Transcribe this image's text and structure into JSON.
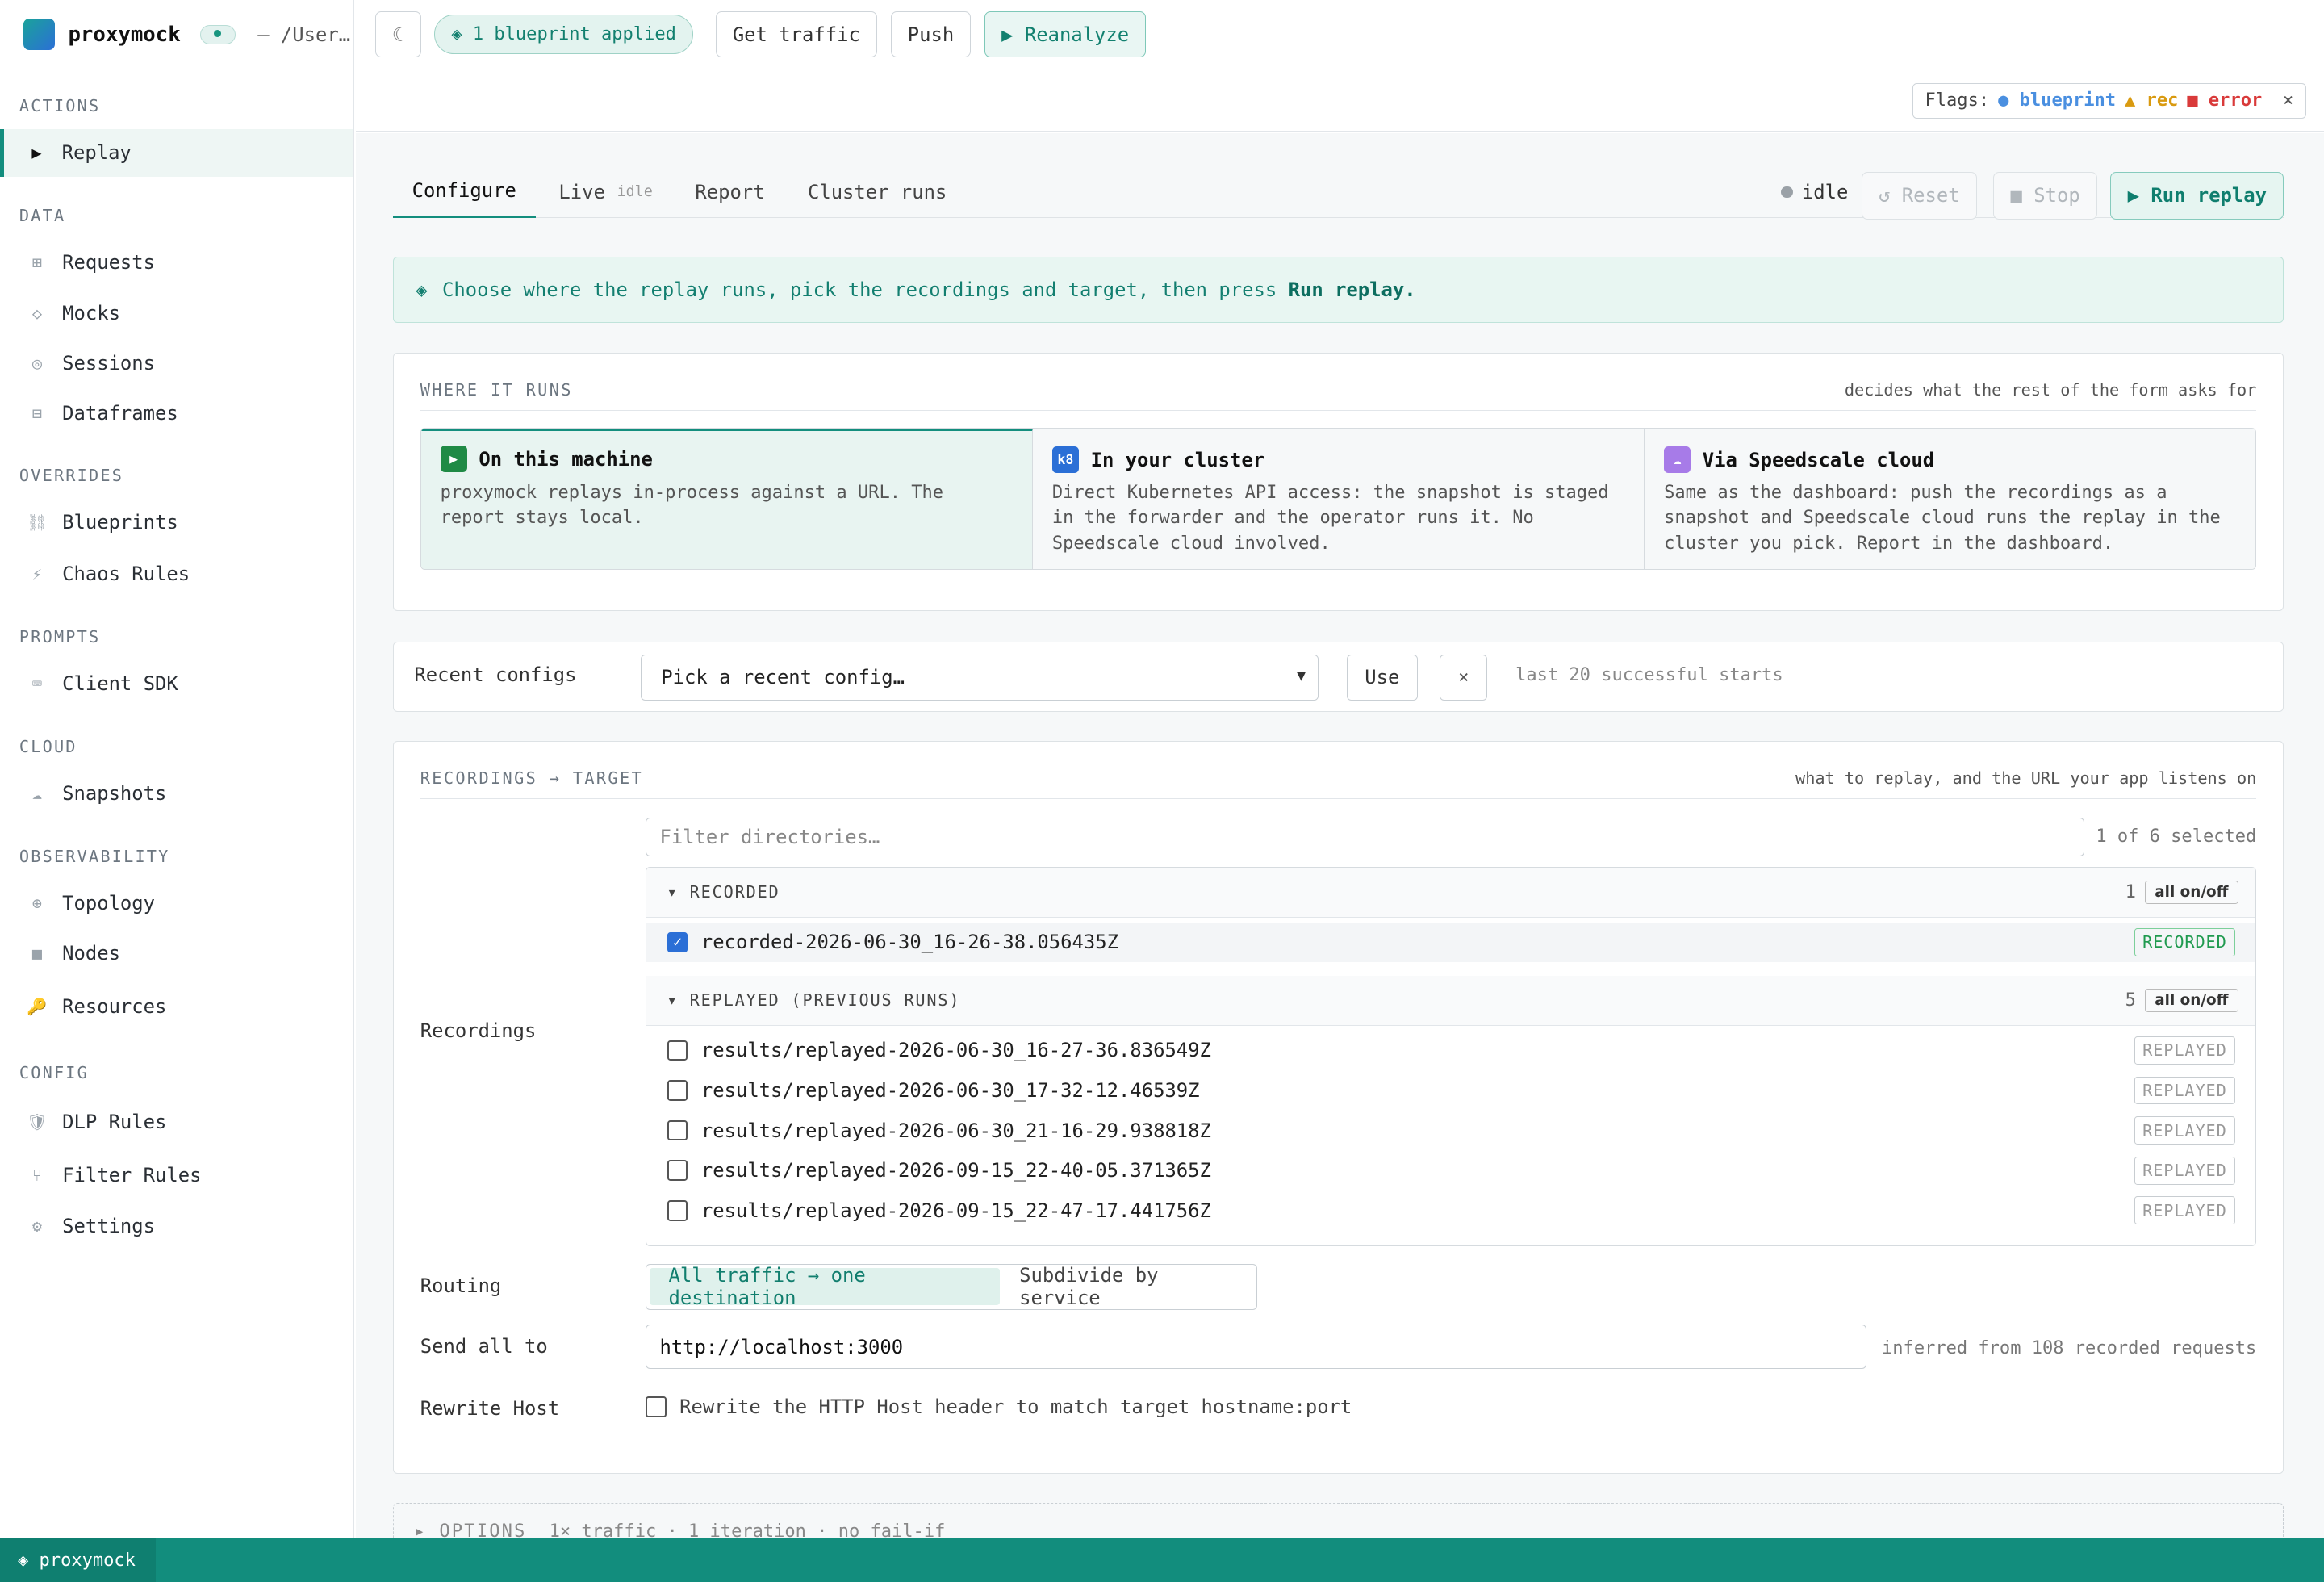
{
  "app": {
    "name": "proxymock",
    "path": "— /User…"
  },
  "topbar": {
    "moon": "☾",
    "blueprint": "◈ 1 blueprint applied",
    "get_traffic": "Get traffic",
    "push": "Push",
    "reanalyze": "▶ Reanalyze"
  },
  "flags": {
    "label": "Flags:",
    "blueprint": "● blueprint",
    "rec": "▲ rec",
    "error": "■ error",
    "close": "×"
  },
  "sidebar": {
    "sections": {
      "actions": "ACTIONS",
      "data": "DATA",
      "overrides": "OVERRIDES",
      "prompts": "PROMPTS",
      "cloud": "CLOUD",
      "observability": "OBSERVABILITY",
      "config": "CONFIG"
    },
    "items": [
      {
        "icon": "▶",
        "label": "Replay"
      },
      {
        "icon": "⊞",
        "label": "Requests"
      },
      {
        "icon": "◇",
        "label": "Mocks"
      },
      {
        "icon": "◎",
        "label": "Sessions"
      },
      {
        "icon": "⊟",
        "label": "Dataframes"
      },
      {
        "icon": "⛓",
        "label": "Blueprints"
      },
      {
        "icon": "⚡",
        "label": "Chaos Rules"
      },
      {
        "icon": "⌨",
        "label": "Client SDK"
      },
      {
        "icon": "☁",
        "label": "Snapshots"
      },
      {
        "icon": "⊕",
        "label": "Topology"
      },
      {
        "icon": "■",
        "label": "Nodes"
      },
      {
        "icon": "🔑",
        "label": "Resources"
      },
      {
        "icon": "🛡",
        "label": "DLP Rules"
      },
      {
        "icon": "⑂",
        "label": "Filter Rules"
      },
      {
        "icon": "⚙",
        "label": "Settings"
      }
    ]
  },
  "tabs": {
    "configure": "Configure",
    "live": "Live",
    "live_sub": "idle",
    "report": "Report",
    "cluster": "Cluster runs"
  },
  "run_state": {
    "status": "idle",
    "reset": "↺ Reset",
    "stop": "■ Stop",
    "run": "▶ Run replay"
  },
  "hint": {
    "icon": "◈",
    "text": "Choose where the replay runs, pick the recordings and target, then press",
    "emphasis": "Run replay."
  },
  "where": {
    "title": "WHERE IT RUNS",
    "note": "decides what the rest of the form asks for",
    "modes": [
      {
        "icon": "▶",
        "title": "On this machine",
        "desc": "proxymock replays in-process against a URL. The report stays local.",
        "color": "#1f8a45"
      },
      {
        "icon": "k8",
        "title": "In your cluster",
        "desc": "Direct Kubernetes API access: the snapshot is staged in the forwarder and the operator runs it. No Speedscale cloud involved.",
        "color": "#2b6fd6"
      },
      {
        "icon": "☁",
        "title": "Via Speedscale cloud",
        "desc": "Same as the dashboard: push the recordings as a snapshot and Speedscale cloud runs the replay in the cluster you pick. Report in the dashboard.",
        "color": "#a77be8"
      }
    ]
  },
  "recent": {
    "label": "Recent configs",
    "select": "Pick a recent config…",
    "use": "Use",
    "clear": "×",
    "note": "last 20 successful starts"
  },
  "recordings": {
    "title": "RECORDINGS → TARGET",
    "note": "what to replay, and the URL your app listens on",
    "label": "Recordings",
    "filter_placeholder": "Filter directories…",
    "selected": "1 of 6 selected",
    "recorded_group": {
      "title": "▾ RECORDED",
      "count": "1",
      "toggle": "all on/off"
    },
    "recorded_items": [
      {
        "name": "recorded-2026-06-30_16-26-38.056435Z",
        "tag": "RECORDED"
      }
    ],
    "replayed_group": {
      "title": "▾ REPLAYED (PREVIOUS RUNS)",
      "count": "5",
      "toggle": "all on/off"
    },
    "replayed_items": [
      {
        "name": "results/replayed-2026-06-30_16-27-36.836549Z",
        "tag": "REPLAYED"
      },
      {
        "name": "results/replayed-2026-06-30_17-32-12.46539Z",
        "tag": "REPLAYED"
      },
      {
        "name": "results/replayed-2026-06-30_21-16-29.938818Z",
        "tag": "REPLAYED"
      },
      {
        "name": "results/replayed-2026-09-15_22-40-05.371365Z",
        "tag": "REPLAYED"
      },
      {
        "name": "results/replayed-2026-09-15_22-47-17.441756Z",
        "tag": "REPLAYED"
      }
    ],
    "routing_label": "Routing",
    "routing_all": "All traffic → one destination",
    "routing_sub": "Subdivide by service",
    "send_label": "Send all to",
    "send_value": "http://localhost:3000",
    "send_note": "inferred from 108 recorded requests",
    "rewrite_label": "Rewrite Host",
    "rewrite_text": "Rewrite the HTTP Host header to match target hostname:port"
  },
  "options": {
    "title": "▸ OPTIONS",
    "summary": "1× traffic · 1 iteration · no fail-if"
  },
  "statusbar": {
    "label": "◈ proxymock"
  }
}
